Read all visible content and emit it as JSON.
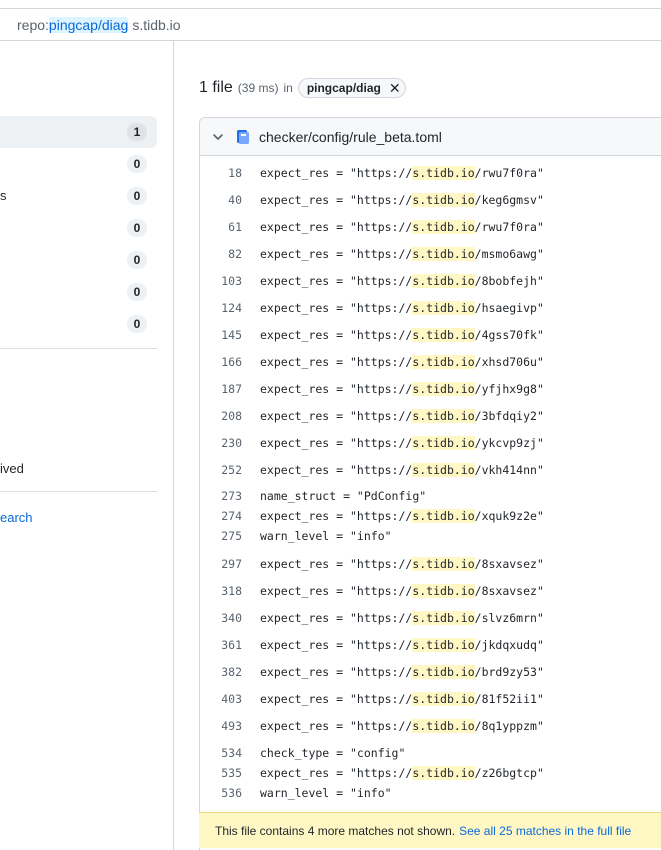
{
  "search": {
    "qualifier_key": "repo:",
    "qualifier_value": "pingcap/diag",
    "query_text": "s.tidb.io"
  },
  "sidebar": {
    "items": [
      {
        "label": "",
        "count": "1",
        "selected": true
      },
      {
        "label": "",
        "count": "0"
      },
      {
        "label": "s",
        "count": "0"
      },
      {
        "label": "",
        "count": "0"
      },
      {
        "label": "",
        "count": "0"
      },
      {
        "label": "",
        "count": "0"
      },
      {
        "label": "",
        "count": "0"
      }
    ],
    "archived_text": "ived",
    "search_link": "earch"
  },
  "results": {
    "count_label": "1 file",
    "time_label": "(39 ms)",
    "in_label": "in",
    "repo_chip": "pingcap/diag"
  },
  "file": {
    "path": "checker/config/rule_beta.toml",
    "lines": [
      {
        "num": "18",
        "pre": "expect_res = \"https://",
        "match": "s.tidb.io",
        "post": "/rwu7f0ra\""
      },
      {
        "num": "40",
        "pre": "expect_res = \"https://",
        "match": "s.tidb.io",
        "post": "/keg6gmsv\""
      },
      {
        "num": "61",
        "pre": "expect_res = \"https://",
        "match": "s.tidb.io",
        "post": "/rwu7f0ra\""
      },
      {
        "num": "82",
        "pre": "expect_res = \"https://",
        "match": "s.tidb.io",
        "post": "/msmo6awg\""
      },
      {
        "num": "103",
        "pre": "expect_res = \"https://",
        "match": "s.tidb.io",
        "post": "/8bobfejh\""
      },
      {
        "num": "124",
        "pre": "expect_res = \"https://",
        "match": "s.tidb.io",
        "post": "/hsaegivp\""
      },
      {
        "num": "145",
        "pre": "expect_res = \"https://",
        "match": "s.tidb.io",
        "post": "/4gss70fk\""
      },
      {
        "num": "166",
        "pre": "expect_res = \"https://",
        "match": "s.tidb.io",
        "post": "/xhsd706u\""
      },
      {
        "num": "187",
        "pre": "expect_res = \"https://",
        "match": "s.tidb.io",
        "post": "/yfjhx9g8\""
      },
      {
        "num": "208",
        "pre": "expect_res = \"https://",
        "match": "s.tidb.io",
        "post": "/3bfdqiy2\""
      },
      {
        "num": "230",
        "pre": "expect_res = \"https://",
        "match": "s.tidb.io",
        "post": "/ykcvp9zj\""
      },
      {
        "num": "252",
        "pre": "expect_res = \"https://",
        "match": "s.tidb.io",
        "post": "/vkh414nn\""
      },
      {
        "num": "273",
        "pre": "name_struct = \"PdConfig\"",
        "match": "",
        "post": ""
      },
      {
        "num": "274",
        "pre": "expect_res = \"https://",
        "match": "s.tidb.io",
        "post": "/xquk9z2e\""
      },
      {
        "num": "275",
        "pre": "warn_level = \"info\"",
        "match": "",
        "post": ""
      },
      {
        "num": "297",
        "pre": "expect_res = \"https://",
        "match": "s.tidb.io",
        "post": "/8sxavsez\""
      },
      {
        "num": "318",
        "pre": "expect_res = \"https://",
        "match": "s.tidb.io",
        "post": "/8sxavsez\""
      },
      {
        "num": "340",
        "pre": "expect_res = \"https://",
        "match": "s.tidb.io",
        "post": "/slvz6mrn\""
      },
      {
        "num": "361",
        "pre": "expect_res = \"https://",
        "match": "s.tidb.io",
        "post": "/jkdqxudq\""
      },
      {
        "num": "382",
        "pre": "expect_res = \"https://",
        "match": "s.tidb.io",
        "post": "/brd9zy53\""
      },
      {
        "num": "403",
        "pre": "expect_res = \"https://",
        "match": "s.tidb.io",
        "post": "/81f52ii1\""
      },
      {
        "num": "493",
        "pre": "expect_res = \"https://",
        "match": "s.tidb.io",
        "post": "/8q1yppzm\""
      },
      {
        "num": "534",
        "pre": "check_type = \"config\"",
        "match": "",
        "post": ""
      },
      {
        "num": "535",
        "pre": "expect_res = \"https://",
        "match": "s.tidb.io",
        "post": "/z26bgtcp\""
      },
      {
        "num": "536",
        "pre": "warn_level = \"info\"",
        "match": "",
        "post": ""
      }
    ]
  },
  "footer": {
    "text": "This file contains 4 more matches not shown.",
    "link": "See all 25 matches in the full file"
  },
  "colors": {
    "accent": "#0969da",
    "match_highlight": "#fff8c5",
    "border": "#d0d7de"
  }
}
